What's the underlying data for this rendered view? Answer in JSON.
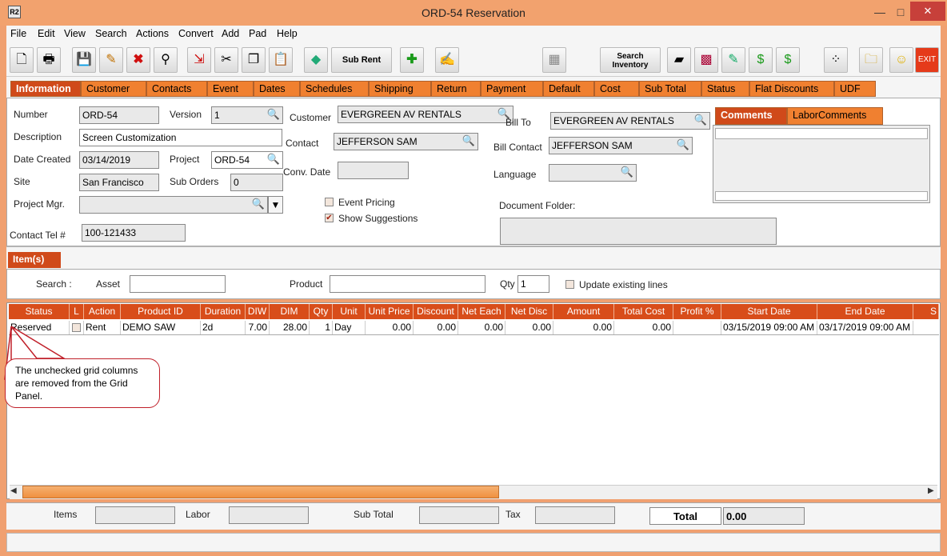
{
  "window": {
    "title": "ORD-54 Reservation",
    "app_icon": "R2",
    "minimize": "—",
    "maximize": "□",
    "close": "✕"
  },
  "menu": [
    "File",
    "Edit",
    "View",
    "Search",
    "Actions",
    "Convert",
    "Add",
    "Pad",
    "Help"
  ],
  "toolbar": {
    "sub_rent": "Sub Rent",
    "search_inventory_1": "Search",
    "search_inventory_2": "Inventory",
    "exit": "EXIT"
  },
  "tabs": [
    "Information",
    "Customer",
    "Contacts",
    "Event",
    "Dates",
    "Schedules",
    "Shipping",
    "Return",
    "Payment",
    "Default",
    "Cost",
    "Sub Total",
    "Status",
    "Flat Discounts",
    "UDF"
  ],
  "info": {
    "number_label": "Number",
    "number": "ORD-54",
    "version_label": "Version",
    "version": "1",
    "description_label": "Description",
    "description": "Screen Customization",
    "date_created_label": "Date Created",
    "date_created": "03/14/2019",
    "project_label": "Project",
    "project": "ORD-54",
    "site_label": "Site",
    "site": "San Francisco",
    "sub_orders_label": "Sub Orders",
    "sub_orders": "0",
    "project_mgr_label": "Project Mgr.",
    "project_mgr": "",
    "contact_tel_label": "Contact Tel #",
    "contact_tel": "100-121433",
    "customer_label": "Customer",
    "customer": "EVERGREEN AV RENTALS",
    "contact_label": "Contact",
    "contact": "JEFFERSON SAM",
    "conv_date_label": "Conv. Date",
    "conv_date": "",
    "event_pricing": "Event Pricing",
    "show_suggestions": "Show Suggestions",
    "bill_to_label": "Bill To",
    "bill_to": "EVERGREEN AV RENTALS",
    "bill_contact_label": "Bill Contact",
    "bill_contact": "JEFFERSON SAM",
    "language_label": "Language",
    "language": "",
    "document_folder_label": "Document Folder:",
    "comments_tab": "Comments",
    "labor_comments_tab": "LaborComments"
  },
  "items": {
    "tab": "Item(s)",
    "search_label": "Search :",
    "asset_label": "Asset",
    "product_label": "Product",
    "qty_label": "Qty",
    "qty": "1",
    "update_existing": "Update existing lines"
  },
  "grid": {
    "headers": [
      "Status",
      "L",
      "Action",
      "Product ID",
      "Duration",
      "DIW",
      "DIM",
      "Qty",
      "Unit",
      "Unit Price",
      "Discount",
      "Net Each",
      "Net Disc",
      "Amount",
      "Total Cost",
      "Profit %",
      "Start Date",
      "End Date",
      "S"
    ],
    "rows": [
      [
        "Reserved",
        "",
        "Rent",
        "DEMO SAW",
        "2d",
        "7.00",
        "28.00",
        "1",
        "Day",
        "0.00",
        "0.00",
        "0.00",
        "0.00",
        "0.00",
        "0.00",
        "",
        "03/15/2019 09:00 AM",
        "03/17/2019 09:00 AM",
        ""
      ]
    ]
  },
  "callout": "The unchecked grid columns are removed from the Grid Panel.",
  "totals": {
    "items_label": "Items",
    "labor_label": "Labor",
    "sub_total_label": "Sub Total",
    "tax_label": "Tax",
    "total_label": "Total",
    "total": "0.00"
  }
}
